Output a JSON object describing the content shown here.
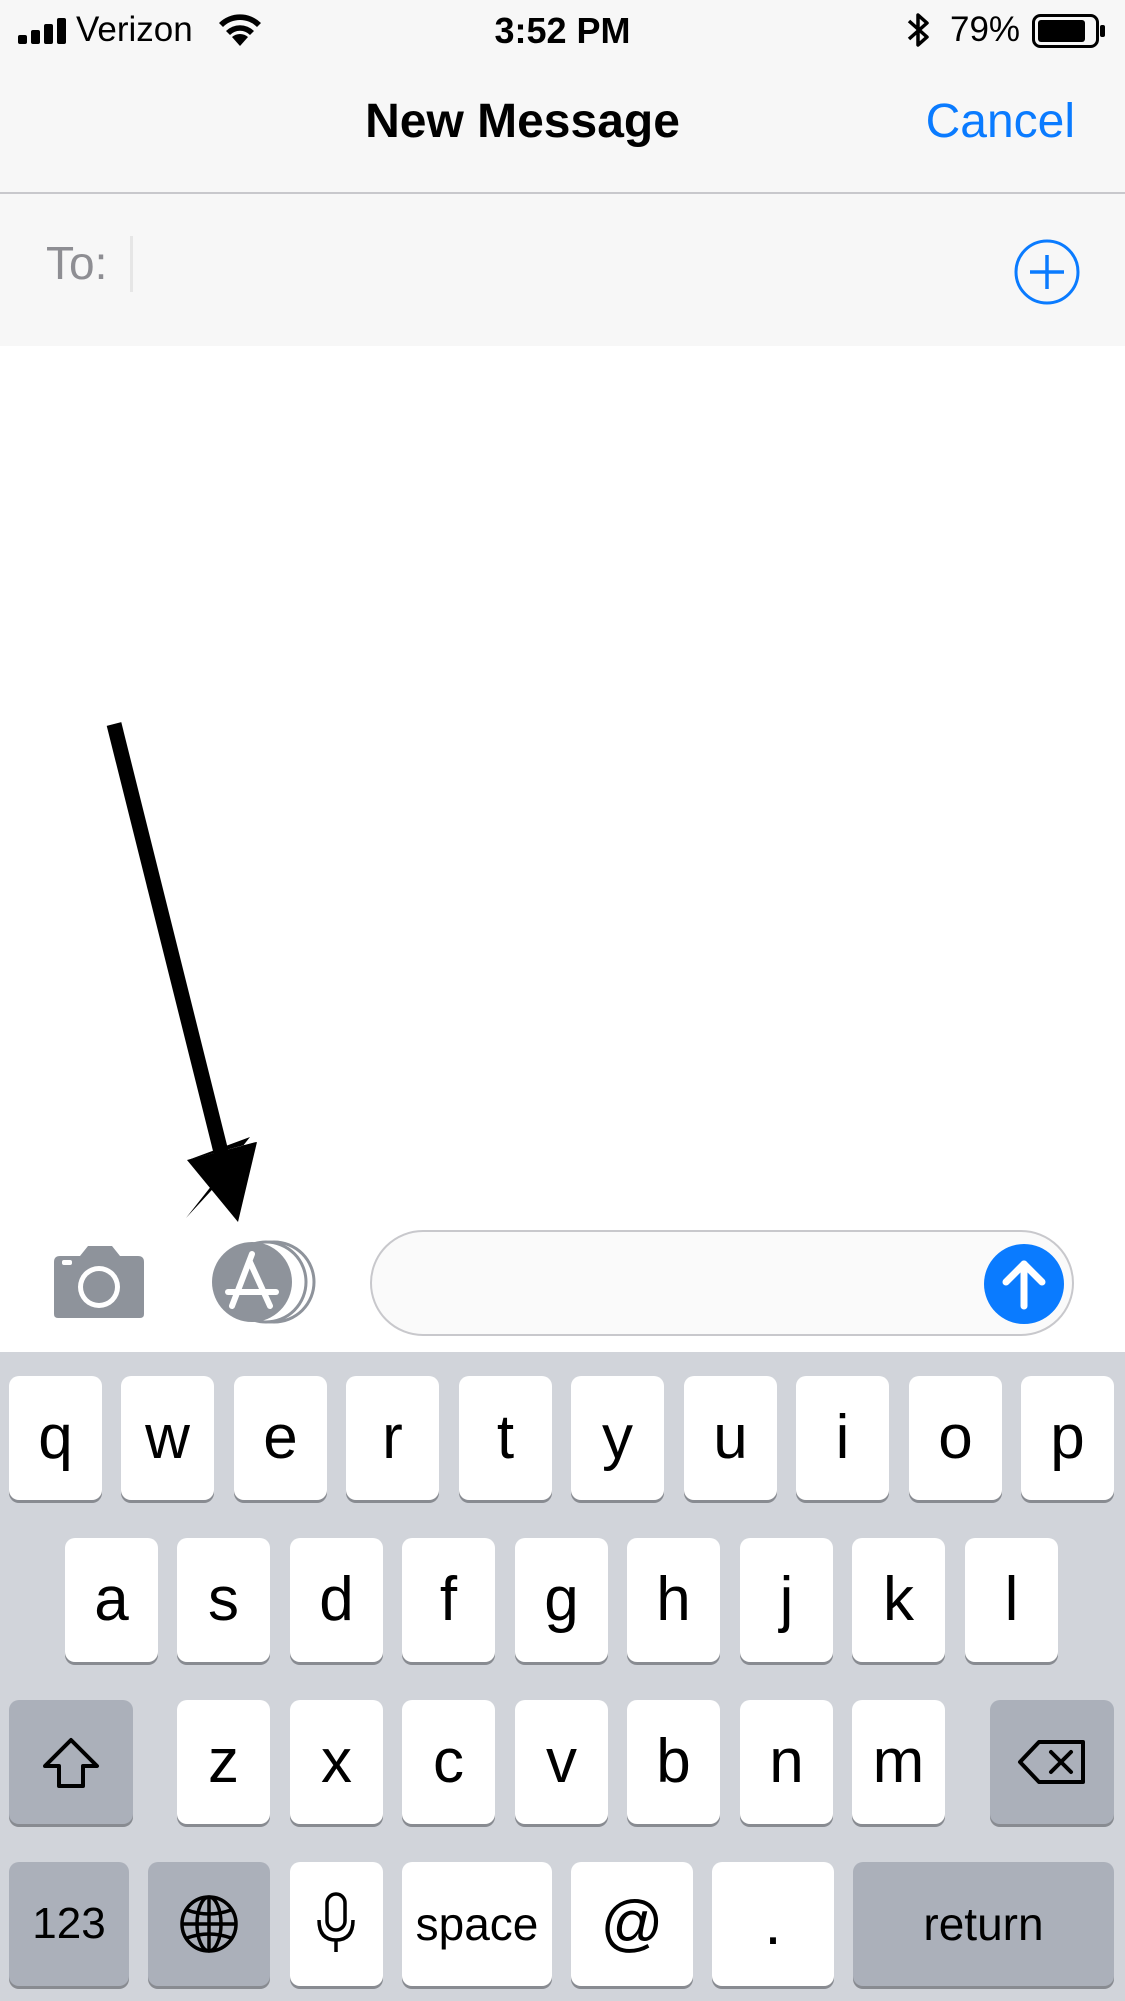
{
  "status_bar": {
    "carrier": "Verizon",
    "time": "3:52 PM",
    "battery_percent": "79%",
    "signal_icon": "cellular-signal-icon",
    "wifi_icon": "wifi-icon",
    "bluetooth_icon": "bluetooth-icon",
    "battery_icon": "battery-icon"
  },
  "nav": {
    "title": "New Message",
    "cancel_label": "Cancel"
  },
  "to_field": {
    "label": "To:",
    "add_icon": "plus-circle-icon"
  },
  "compose": {
    "camera_icon": "camera-icon",
    "appstore_icon": "app-store-icon",
    "send_icon": "send-arrow-icon"
  },
  "annotation": {
    "arrow_icon": "annotation-arrow-icon"
  },
  "keyboard": {
    "row1": [
      "q",
      "w",
      "e",
      "r",
      "t",
      "y",
      "u",
      "i",
      "o",
      "p"
    ],
    "row2": [
      "a",
      "s",
      "d",
      "f",
      "g",
      "h",
      "j",
      "k",
      "l"
    ],
    "row3": [
      "z",
      "x",
      "c",
      "v",
      "b",
      "n",
      "m"
    ],
    "numbers_label": "123",
    "space_label": "space",
    "at_label": "@",
    "period_label": ".",
    "return_label": "return",
    "shift_icon": "shift-icon",
    "delete_icon": "delete-icon",
    "globe_icon": "globe-icon",
    "mic_icon": "microphone-icon"
  },
  "colors": {
    "accent": "#0a7bff",
    "keyboard_bg": "#d1d4da",
    "key_bg": "#ffffff",
    "key_dark_bg": "#abb0ba"
  }
}
